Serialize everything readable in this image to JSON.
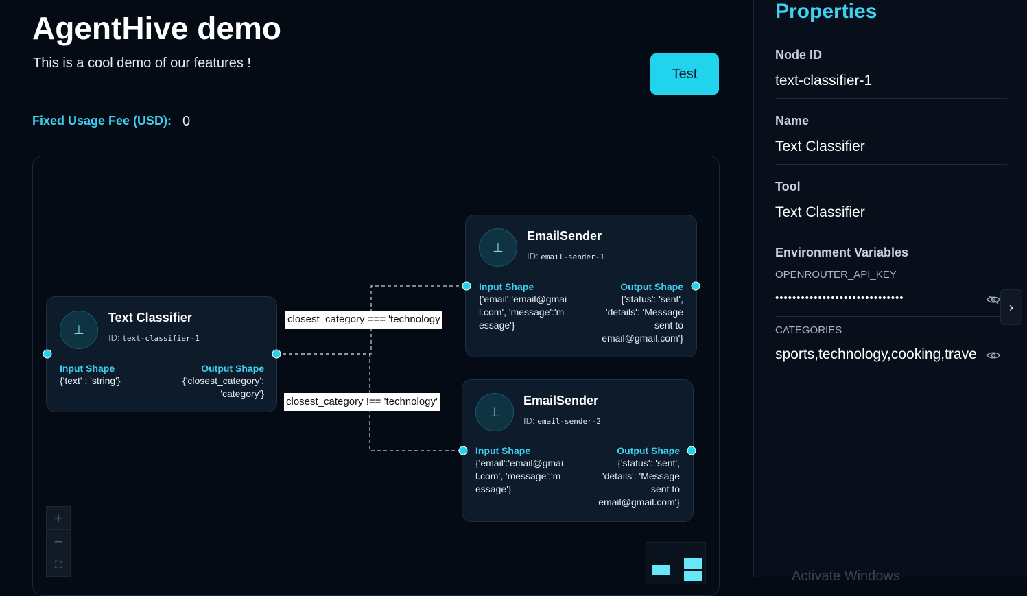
{
  "header": {
    "title": "AgentHive demo",
    "subtitle": "This is a cool demo of our features !",
    "test_button": "Test"
  },
  "fee": {
    "label": "Fixed Usage Fee (USD):",
    "value": "0"
  },
  "flow": {
    "nodes": [
      {
        "title": "Text Classifier",
        "id_label": "ID:",
        "id": "text-classifier-1",
        "input_label": "Input Shape",
        "input_shape": "{'text' : 'string'}",
        "output_label": "Output Shape",
        "output_shape": "{'closest_category': 'category'}"
      },
      {
        "title": "EmailSender",
        "id_label": "ID:",
        "id": "email-sender-1",
        "input_label": "Input Shape",
        "input_shape": "{'email':'email@gmail.com', 'message':'message'}",
        "output_label": "Output Shape",
        "output_shape": "{'status': 'sent', 'details': 'Message sent to email@gmail.com'}"
      },
      {
        "title": "EmailSender",
        "id_label": "ID:",
        "id": "email-sender-2",
        "input_label": "Input Shape",
        "input_shape": "{'email':'email@gmail.com', 'message':'message'}",
        "output_label": "Output Shape",
        "output_shape": "{'status': 'sent', 'details': 'Message sent to email@gmail.com'}"
      }
    ],
    "edge_labels": [
      "closest_category === 'technology",
      "closest_category !== 'technology'"
    ],
    "controls": {
      "zoom_in": "+",
      "zoom_out": "−",
      "fit": "⛶"
    }
  },
  "properties": {
    "title": "Properties",
    "node_id_label": "Node ID",
    "node_id_value": "text-classifier-1",
    "name_label": "Name",
    "name_value": "Text Classifier",
    "tool_label": "Tool",
    "tool_value": "Text Classifier",
    "env_label": "Environment Variables",
    "env_vars": [
      {
        "key": "OPENROUTER_API_KEY",
        "value": "••••••••••••••••••••••••••••••"
      },
      {
        "key": "CATEGORIES",
        "value": "sports,technology,cooking,trave"
      }
    ],
    "expand_icon": "›"
  },
  "icons": {
    "node_icon": "upload-icon",
    "hidden_eye": "eye-off-icon",
    "visible_eye": "eye-icon"
  },
  "colors": {
    "accent": "#22d3ee",
    "background": "#040b15",
    "node_bg": "#0e1b2b",
    "label_cyan": "#3fd0f0"
  },
  "os_overlay": {
    "watermark": "Activate Windows"
  }
}
